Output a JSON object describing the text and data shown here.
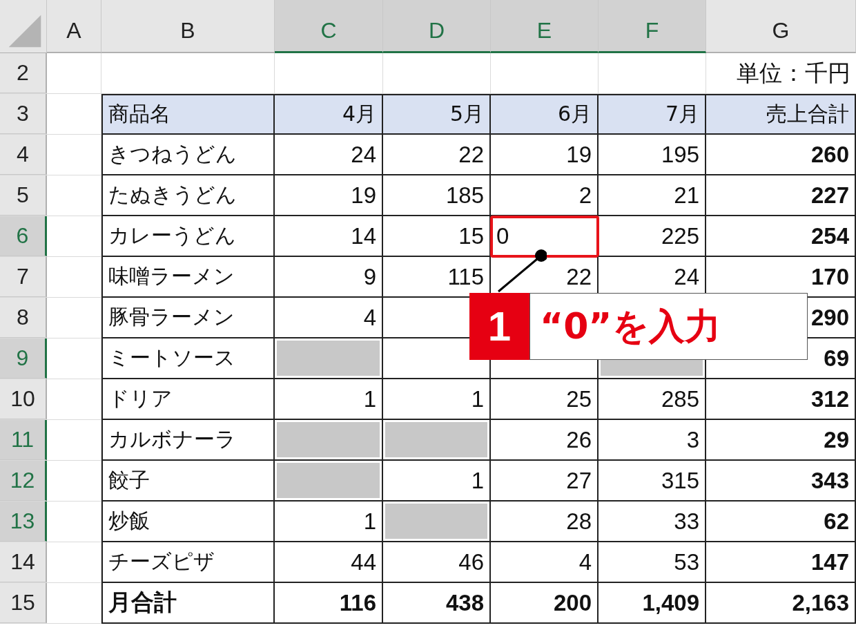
{
  "column_headers": [
    {
      "label": "A",
      "selected": false
    },
    {
      "label": "B",
      "selected": false
    },
    {
      "label": "C",
      "selected": true
    },
    {
      "label": "D",
      "selected": true
    },
    {
      "label": "E",
      "selected": true
    },
    {
      "label": "F",
      "selected": true
    },
    {
      "label": "G",
      "selected": false
    }
  ],
  "rows": [
    {
      "kind": "note",
      "number": "2",
      "selected": false,
      "text": "単位：千円"
    },
    {
      "kind": "header",
      "number": "3",
      "selected": false,
      "name": "商品名",
      "months": [
        "4月",
        "5月",
        "6月",
        "7月"
      ],
      "total": "売上合計"
    },
    {
      "kind": "item",
      "number": "4",
      "selected": false,
      "name": "きつねうどん",
      "cells": [
        {
          "kind": "number",
          "text": "24"
        },
        {
          "kind": "number",
          "text": "22"
        },
        {
          "kind": "number",
          "text": "19"
        },
        {
          "kind": "number",
          "text": "195"
        }
      ],
      "total": "260"
    },
    {
      "kind": "item",
      "number": "5",
      "selected": false,
      "name": "たぬきうどん",
      "cells": [
        {
          "kind": "number",
          "text": "19"
        },
        {
          "kind": "number",
          "text": "185"
        },
        {
          "kind": "number",
          "text": "2"
        },
        {
          "kind": "number",
          "text": "21"
        }
      ],
      "total": "227"
    },
    {
      "kind": "item",
      "number": "6",
      "selected": true,
      "name": "カレーうどん",
      "cells": [
        {
          "kind": "number",
          "text": "14"
        },
        {
          "kind": "number",
          "text": "15"
        },
        {
          "kind": "input",
          "text": "0"
        },
        {
          "kind": "number",
          "text": "225"
        }
      ],
      "total": "254"
    },
    {
      "kind": "item",
      "number": "7",
      "selected": false,
      "name": "味噌ラーメン",
      "cells": [
        {
          "kind": "number",
          "text": "9"
        },
        {
          "kind": "number",
          "text": "115"
        },
        {
          "kind": "number",
          "text": "22"
        },
        {
          "kind": "number",
          "text": "24"
        }
      ],
      "total": "170"
    },
    {
      "kind": "item",
      "number": "8",
      "selected": false,
      "name": "豚骨ラーメン",
      "cells": [
        {
          "kind": "number",
          "text": "4"
        },
        {
          "kind": "number"
        },
        {
          "kind": "number"
        },
        {
          "kind": "number"
        }
      ],
      "total": "290"
    },
    {
      "kind": "item",
      "number": "9",
      "selected": true,
      "name": "ミートソース",
      "cells": [
        {
          "kind": "blank"
        },
        {
          "kind": "empty"
        },
        {
          "kind": "empty"
        },
        {
          "kind": "blank"
        }
      ],
      "total": "69"
    },
    {
      "kind": "item",
      "number": "10",
      "selected": false,
      "name": "ドリア",
      "cells": [
        {
          "kind": "number",
          "text": "1"
        },
        {
          "kind": "number",
          "text": "1"
        },
        {
          "kind": "number",
          "text": "25"
        },
        {
          "kind": "number",
          "text": "285"
        }
      ],
      "total": "312"
    },
    {
      "kind": "item",
      "number": "11",
      "selected": true,
      "name": "カルボナーラ",
      "cells": [
        {
          "kind": "blank"
        },
        {
          "kind": "blank"
        },
        {
          "kind": "number",
          "text": "26"
        },
        {
          "kind": "number",
          "text": "3"
        }
      ],
      "total": "29"
    },
    {
      "kind": "item",
      "number": "12",
      "selected": true,
      "name": "餃子",
      "cells": [
        {
          "kind": "blank"
        },
        {
          "kind": "number",
          "text": "1"
        },
        {
          "kind": "number",
          "text": "27"
        },
        {
          "kind": "number",
          "text": "315"
        }
      ],
      "total": "343"
    },
    {
      "kind": "item",
      "number": "13",
      "selected": true,
      "name": "炒飯",
      "cells": [
        {
          "kind": "number",
          "text": "1"
        },
        {
          "kind": "blank"
        },
        {
          "kind": "number",
          "text": "28"
        },
        {
          "kind": "number",
          "text": "33"
        }
      ],
      "total": "62"
    },
    {
      "kind": "item",
      "number": "14",
      "selected": false,
      "name": "チーズピザ",
      "cells": [
        {
          "kind": "number",
          "text": "44"
        },
        {
          "kind": "number",
          "text": "46"
        },
        {
          "kind": "number",
          "text": "4"
        },
        {
          "kind": "number",
          "text": "53"
        }
      ],
      "total": "147"
    },
    {
      "kind": "sum",
      "number": "15",
      "selected": false,
      "name": "月合計",
      "cells": [
        {
          "kind": "number",
          "text": "116"
        },
        {
          "kind": "number",
          "text": "438"
        },
        {
          "kind": "number",
          "text": "200"
        },
        {
          "kind": "number",
          "text": "1,409"
        }
      ],
      "total": "2,163"
    }
  ],
  "callout": {
    "number": "1",
    "text": "“0”を入力"
  }
}
